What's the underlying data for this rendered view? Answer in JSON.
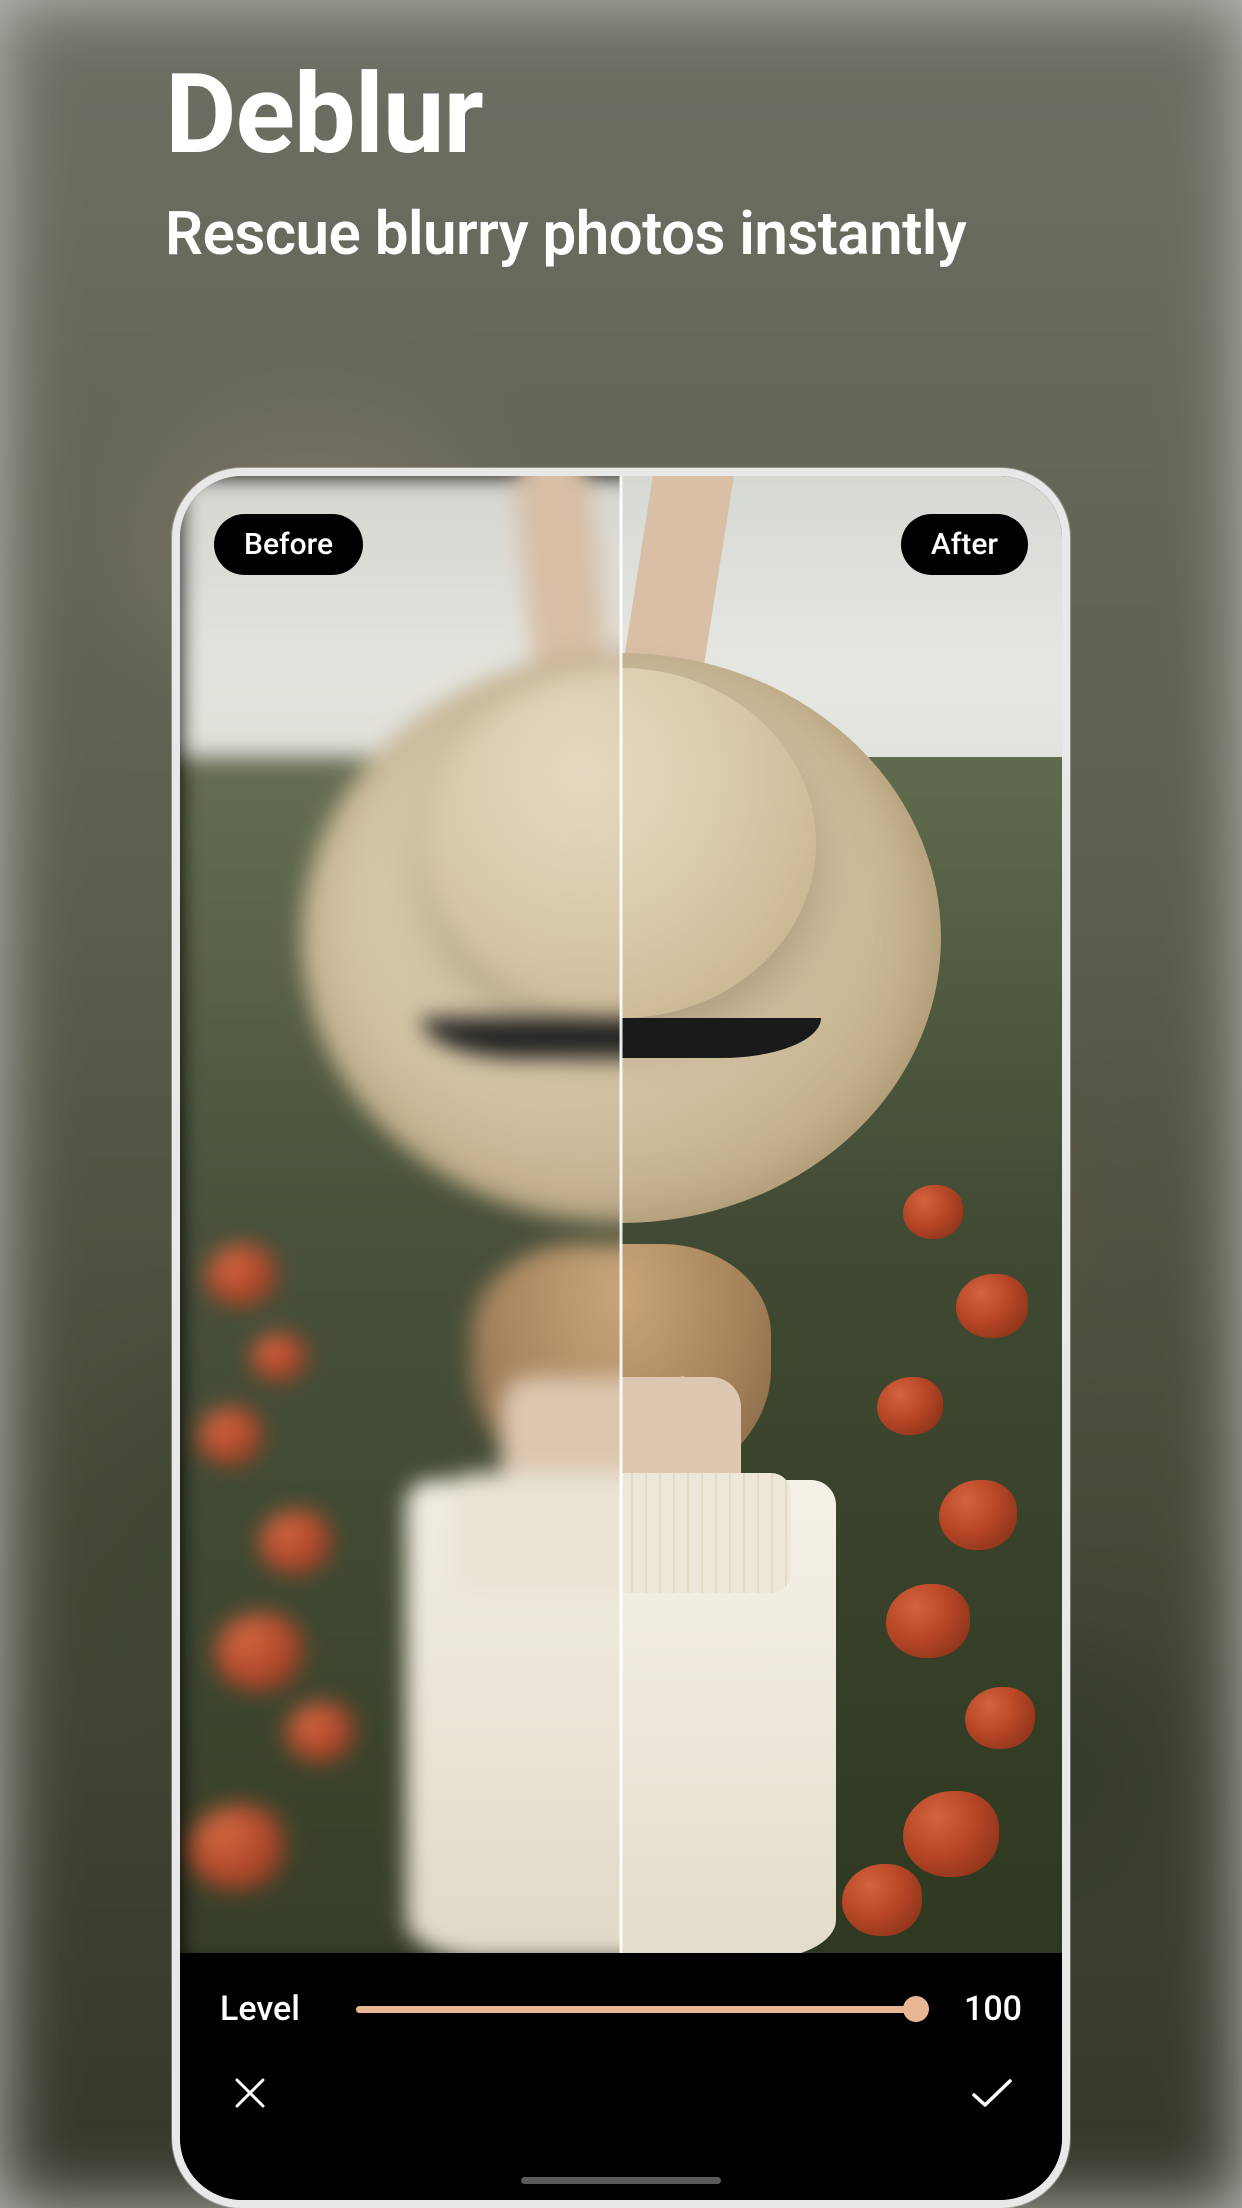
{
  "header": {
    "title": "Deblur",
    "subtitle": "Rescue blurry photos instantly"
  },
  "comparison": {
    "before_label": "Before",
    "after_label": "After"
  },
  "controls": {
    "slider_label": "Level",
    "slider_value": "100",
    "slider_percent": 100
  },
  "actions": {
    "cancel": "close",
    "confirm": "check"
  },
  "colors": {
    "accent": "#e9b695",
    "pill_bg": "#000000",
    "text_light": "#ffffff"
  }
}
